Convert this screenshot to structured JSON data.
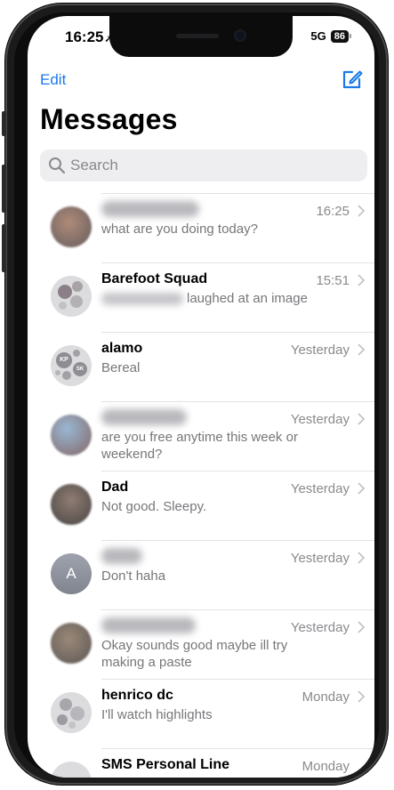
{
  "status": {
    "time": "16:25",
    "location_glyph": "➚",
    "network": "5G",
    "battery": "86"
  },
  "nav": {
    "edit_label": "Edit",
    "compose_icon": "compose-icon"
  },
  "title": "Messages",
  "search": {
    "placeholder": "Search"
  },
  "colors": {
    "accent": "#1a7ae8",
    "secondary_text": "#8a8a8e"
  },
  "conversations": [
    {
      "name": "",
      "preview": "what are you doing today?",
      "time": "16:25",
      "avatar": "photo"
    },
    {
      "name": "Barefoot Squad",
      "preview": "laughed at an image",
      "time": "15:51",
      "avatar": "group"
    },
    {
      "name": "alamo",
      "preview": "Bereal",
      "time": "Yesterday",
      "avatar": "group-initials"
    },
    {
      "name": "",
      "preview": "are you free anytime this week or weekend?",
      "time": "Yesterday",
      "avatar": "photo"
    },
    {
      "name": "Dad",
      "preview": "Not good. Sleepy.",
      "time": "Yesterday",
      "avatar": "photo"
    },
    {
      "name": "",
      "preview": "Don't haha",
      "time": "Yesterday",
      "avatar": "initial",
      "initial": "A"
    },
    {
      "name": "",
      "preview": "Okay sounds good maybe ill try making a paste",
      "time": "Yesterday",
      "avatar": "photo"
    },
    {
      "name": "henrico dc",
      "preview": "I'll watch highlights",
      "time": "Monday",
      "avatar": "group"
    },
    {
      "name": "SMS Personal Line",
      "preview": "",
      "time": "Monday",
      "avatar": "group"
    }
  ],
  "group_initials": [
    "KP",
    "SK"
  ]
}
